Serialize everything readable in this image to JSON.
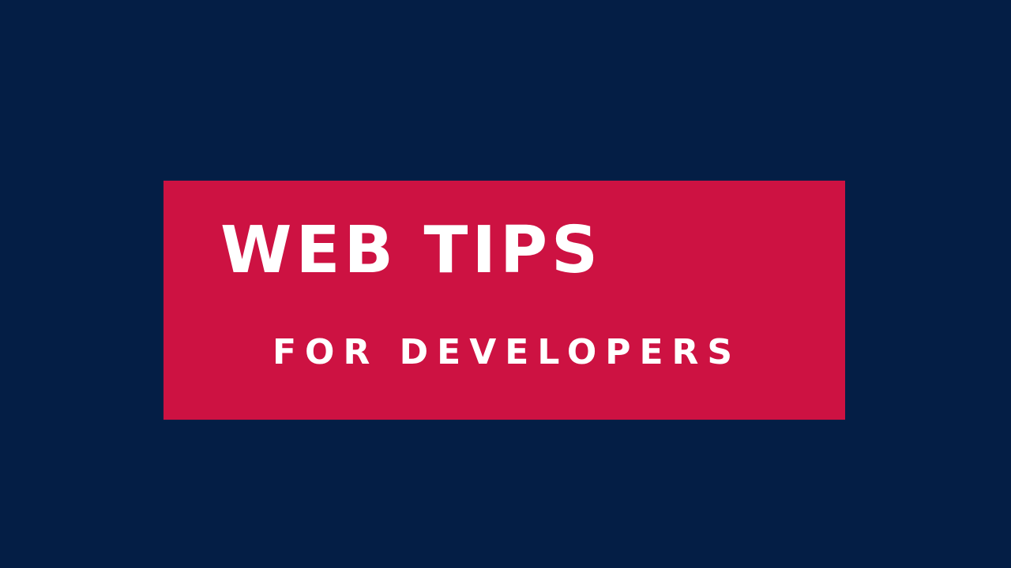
{
  "banner": {
    "headline": "WEB TIPS",
    "subline": "FOR DEVELOPERS"
  },
  "colors": {
    "background": "#041e45",
    "banner": "#cd1242",
    "text": "#ffffff"
  }
}
